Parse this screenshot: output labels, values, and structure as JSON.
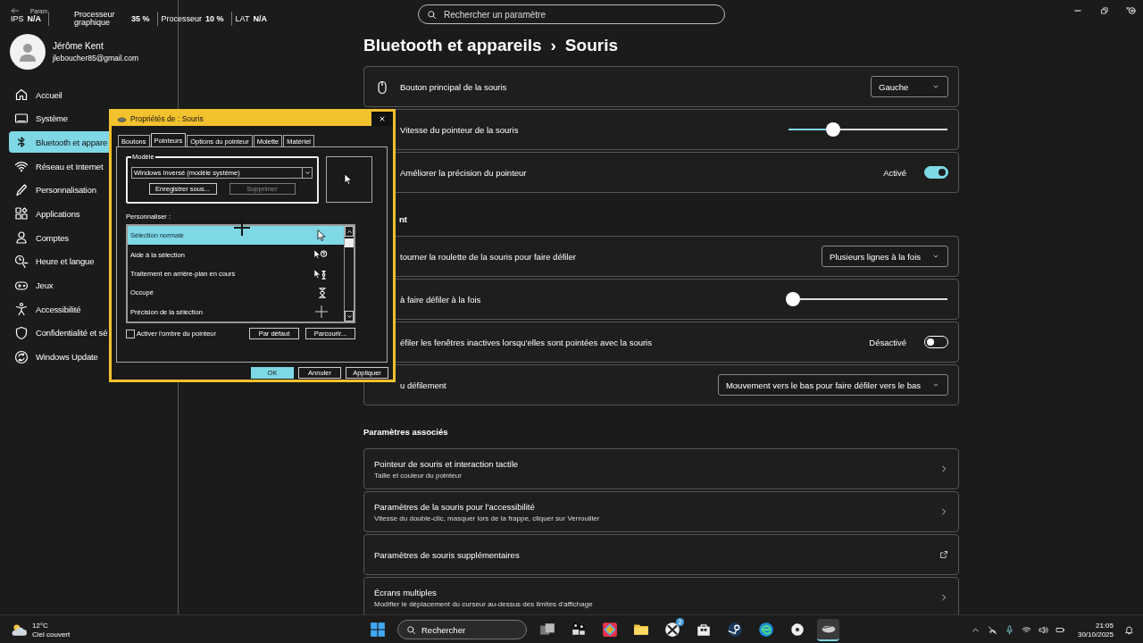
{
  "title_bar": {
    "title": "Param",
    "stats": [
      {
        "label": "IPS",
        "value": "N/A"
      },
      {
        "label": "Processeur graphique",
        "value": "35 %"
      },
      {
        "label": "Processeur",
        "value": "10 %"
      },
      {
        "label": "LAT",
        "value": "N/A"
      }
    ]
  },
  "search": {
    "placeholder": "Rechercher un paramètre"
  },
  "account": {
    "name": "Jérôme Kent",
    "email": "jleboucher85@gmail.com"
  },
  "sidebar": {
    "items": [
      {
        "label": "Accueil",
        "selected": false
      },
      {
        "label": "Système",
        "selected": false
      },
      {
        "label": "Bluetooth et appare",
        "selected": true
      },
      {
        "label": "Réseau et Internet",
        "selected": false
      },
      {
        "label": "Personnalisation",
        "selected": false
      },
      {
        "label": "Applications",
        "selected": false
      },
      {
        "label": "Comptes",
        "selected": false
      },
      {
        "label": "Heure et langue",
        "selected": false
      },
      {
        "label": "Jeux",
        "selected": false
      },
      {
        "label": "Accessibilité",
        "selected": false
      },
      {
        "label": "Confidentialité et sé",
        "selected": false
      },
      {
        "label": "Windows Update",
        "selected": false
      }
    ]
  },
  "breadcrumb": {
    "parent": "Bluetooth et appareils",
    "separator": "›",
    "current": "Souris"
  },
  "sections": [
    {
      "rows": [
        {
          "kind": "dropdown",
          "label": "Bouton principal de la souris",
          "value": "Gauche"
        },
        {
          "kind": "slider",
          "label": "Vitesse du pointeur de la souris",
          "level": 0.28
        },
        {
          "kind": "toggle",
          "label": "Améliorer la précision du pointeur",
          "state_text": "Activé",
          "on": true
        }
      ]
    },
    {
      "heading": "nt",
      "rows": [
        {
          "kind": "dropdown",
          "label": "tourner la roulette de la souris pour faire défiler",
          "value": "Plusieurs lignes à la fois"
        },
        {
          "kind": "slider",
          "label": "à faire défiler à la fois",
          "level": 0.03
        },
        {
          "kind": "toggle",
          "label": "éfiler les fenêtres inactives lorsqu’elles sont pointées avec la souris",
          "state_text": "Désactivé",
          "on": false
        },
        {
          "kind": "dropdown",
          "label": "u défilement",
          "value": "Mouvement vers le bas pour faire défiler vers le bas"
        }
      ]
    },
    {
      "heading": "Paramètres associés",
      "rows": [
        {
          "kind": "link",
          "label": "Pointeur de souris et interaction tactile",
          "description": "Taille et couleur du pointeur"
        },
        {
          "kind": "link",
          "label": "Paramètres de la souris pour l'accessibilité",
          "description": "Vitesse du double-clic, masquer lors de la frappe, cliquer sur Verrouiller"
        },
        {
          "kind": "external_link",
          "label": "Paramètres de souris supplémentaires"
        },
        {
          "kind": "link",
          "label": "Écrans multiples",
          "description": "Modifier le déplacement du curseur au-dessus des limites d'affichage"
        }
      ]
    }
  ],
  "dialog": {
    "title": "Propriétés de : Souris",
    "tabs": [
      {
        "label": "Boutons",
        "selected": false
      },
      {
        "label": "Pointeurs",
        "selected": true
      },
      {
        "label": "Options du pointeur",
        "selected": false
      },
      {
        "label": "Molette",
        "selected": false
      },
      {
        "label": "Matériel",
        "selected": false
      }
    ],
    "scheme_group": "Modèle",
    "scheme_value": "Windows Inversé (modèle système)",
    "scheme_buttons": [
      {
        "label": "Enregistrer sous...",
        "disabled": false
      },
      {
        "label": "Supprimer",
        "disabled": true
      }
    ],
    "customize_label": "Personnaliser :",
    "cursors": [
      {
        "name": "Sélection normale",
        "selected": true
      },
      {
        "name": "Aide à la sélection",
        "selected": false
      },
      {
        "name": "Traitement en arrière-plan en cours",
        "selected": false
      },
      {
        "name": "Occupé",
        "selected": false
      },
      {
        "name": "Précision de la sélection",
        "selected": false
      }
    ],
    "shadow": {
      "label": "Activer l'ombre du pointeur",
      "checked": false
    },
    "list_buttons": [
      "Par défaut",
      "Parcourir..."
    ],
    "footer_buttons": [
      {
        "label": "OK",
        "default": true
      },
      {
        "label": "Annuler",
        "default": false
      },
      {
        "label": "Appliquer",
        "default": false
      }
    ]
  },
  "taskbar": {
    "weather": {
      "temperature": "12°C",
      "condition": "Ciel couvert"
    },
    "search": {
      "placeholder": "Rechercher"
    },
    "apps": [
      {
        "active": false
      },
      {
        "active": false
      },
      {
        "active": false
      },
      {
        "active": false
      },
      {
        "active": false,
        "badge": "2"
      },
      {
        "active": false
      },
      {
        "active": false
      },
      {
        "active": false
      },
      {
        "active": false
      },
      {
        "active": true
      }
    ],
    "time": "21:05",
    "date": "30/10/2025"
  }
}
